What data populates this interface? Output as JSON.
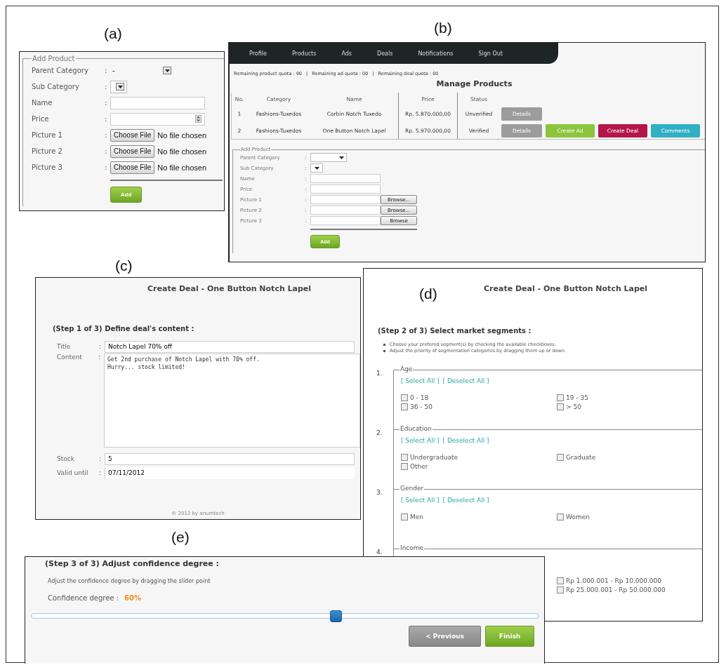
{
  "panel_a": {
    "label": "(a)",
    "legend": "Add Product",
    "fields": [
      {
        "kind": "select",
        "label": "Parent Category",
        "separator": ":",
        "value": "-"
      },
      {
        "kind": "select_small",
        "label": "Sub Category",
        "separator": ":"
      },
      {
        "kind": "text",
        "label": "Name",
        "separator": ":"
      },
      {
        "kind": "number",
        "label": "Price",
        "separator": ":"
      },
      {
        "kind": "file",
        "label": "Picture 1",
        "separator": ":",
        "button": "Choose File",
        "status": "No file chosen"
      },
      {
        "kind": "file",
        "label": "Picture 2",
        "separator": ":",
        "button": "Choose File",
        "status": "No file chosen"
      },
      {
        "kind": "file",
        "label": "Picture 3",
        "separator": ":",
        "button": "Choose File",
        "status": "No file chosen"
      }
    ],
    "submit": "Add"
  },
  "panel_b": {
    "label": "(b)",
    "nav": [
      "Profile",
      "Products",
      "Ads",
      "Deals",
      "Notifications",
      "Sign Out"
    ],
    "quotas": [
      "Remaining product quota : 90",
      "|",
      "Remaining ad quota : 00",
      "|",
      "Remaining deal quota : 00"
    ],
    "title": "Manage Products",
    "columns": [
      "No.",
      "Category",
      "Name",
      "Price",
      "Status"
    ],
    "rows": [
      {
        "cells": [
          "1",
          "Fashions-Tuxedos",
          "Corbin Notch Tuxedo",
          "Rp. 5.870.000,00",
          "Unverified"
        ],
        "actions": [
          {
            "label": "Details",
            "color": "#9c9c9c"
          }
        ]
      },
      {
        "cells": [
          "2",
          "Fashions-Tuxedos",
          "One Button Notch Lapel",
          "Rp. 5.970.000,00",
          "Verified"
        ],
        "actions": [
          {
            "label": "Details",
            "color": "#9c9c9c"
          },
          {
            "label": "Create Ad",
            "color": "#8cc43c"
          },
          {
            "label": "Create Deal",
            "color": "#b3164b"
          },
          {
            "label": "Comments",
            "color": "#31afc4"
          }
        ]
      }
    ],
    "form": {
      "legend": "Add Product",
      "fields": [
        {
          "kind": "select",
          "label": "Parent Category",
          "separator": ":"
        },
        {
          "kind": "select_small",
          "label": "Sub Category",
          "separator": ":"
        },
        {
          "kind": "text",
          "label": "Name",
          "separator": ":"
        },
        {
          "kind": "text",
          "label": "Price",
          "separator": ":"
        },
        {
          "kind": "browse",
          "label": "Picture 1",
          "separator": ":",
          "button": "Browse..."
        },
        {
          "kind": "browse",
          "label": "Picture 2",
          "separator": ":",
          "button": "Browse..."
        },
        {
          "kind": "browse",
          "label": "Picture 3",
          "separator": ":",
          "button": "Browse"
        }
      ],
      "submit": "Add"
    }
  },
  "panel_c": {
    "label": "(c)",
    "title": "Create Deal - One Button Notch Lapel",
    "step": "(Step 1 of 3) Define deal's content :",
    "fields": [
      {
        "kind": "text",
        "label": "Title",
        "separator": ":",
        "value": "Notch Lapel 70% off"
      },
      {
        "kind": "textarea",
        "label": "Content",
        "separator": ":",
        "value": "Get 2nd purchase of Notch Lapel with 70% off.\nHurry... stock limited!"
      },
      {
        "kind": "text",
        "label": "Stock",
        "separator": ":",
        "value": "5"
      },
      {
        "kind": "date",
        "label": "Valid until",
        "separator": ":",
        "value": "07/11/2012"
      }
    ],
    "footer": "© 2012 by anumtech"
  },
  "panel_d": {
    "label": "(d)",
    "title": "Create Deal - One Button Notch Lapel",
    "step": "(Step 2 of 3) Select market segments :",
    "instructions": [
      "Choose your prefered segment(s) by checking the available checkboxes.",
      "Adjust the priority of segmentation categories by dragging them up or down."
    ],
    "groups": [
      {
        "kind": "full",
        "number": "1.",
        "legend": "Age",
        "links": [
          "[ Select All ]",
          "[ Deselect All ]"
        ],
        "options": [
          {
            "label": "0 - 18",
            "checked": false
          },
          {
            "label": "19 - 35",
            "checked": false
          },
          {
            "label": "36 - 50",
            "checked": false
          },
          {
            "label": "> 50",
            "checked": false
          }
        ]
      },
      {
        "kind": "full",
        "number": "2.",
        "legend": "Education",
        "links": [
          "[ Select All ]",
          "[ Deselect All ]"
        ],
        "options": [
          {
            "label": "Undergraduate",
            "checked": false
          },
          {
            "label": "Graduate",
            "checked": false
          },
          {
            "label": "Other",
            "checked": false
          }
        ]
      },
      {
        "kind": "full",
        "number": "3.",
        "legend": "Gender",
        "links": [
          "[ Select All ]",
          "[ Deselect All ]"
        ],
        "options": [
          {
            "label": "Men",
            "checked": false
          },
          {
            "label": "Women",
            "checked": false
          }
        ]
      },
      {
        "kind": "right_only",
        "number": "4.",
        "legend": "Income",
        "options": [
          {
            "label": "Rp 1.000.001 - Rp 10.000.000",
            "checked": false
          },
          {
            "label": "Rp 25.000.001 - Rp 50.000.000",
            "checked": false
          }
        ]
      }
    ]
  },
  "panel_e": {
    "label": "(e)",
    "step": "(Step 3 of 3) Adjust confidence degree :",
    "hint": "Adjust the confidence degree by dragging the slider point",
    "confidence_label": "Confidence degree :",
    "confidence_value": "60%",
    "slider": {
      "level": 0.6
    },
    "buttons": [
      {
        "kind": "secondary",
        "label": "< Previous"
      },
      {
        "kind": "primary",
        "label": "Finish"
      }
    ]
  }
}
